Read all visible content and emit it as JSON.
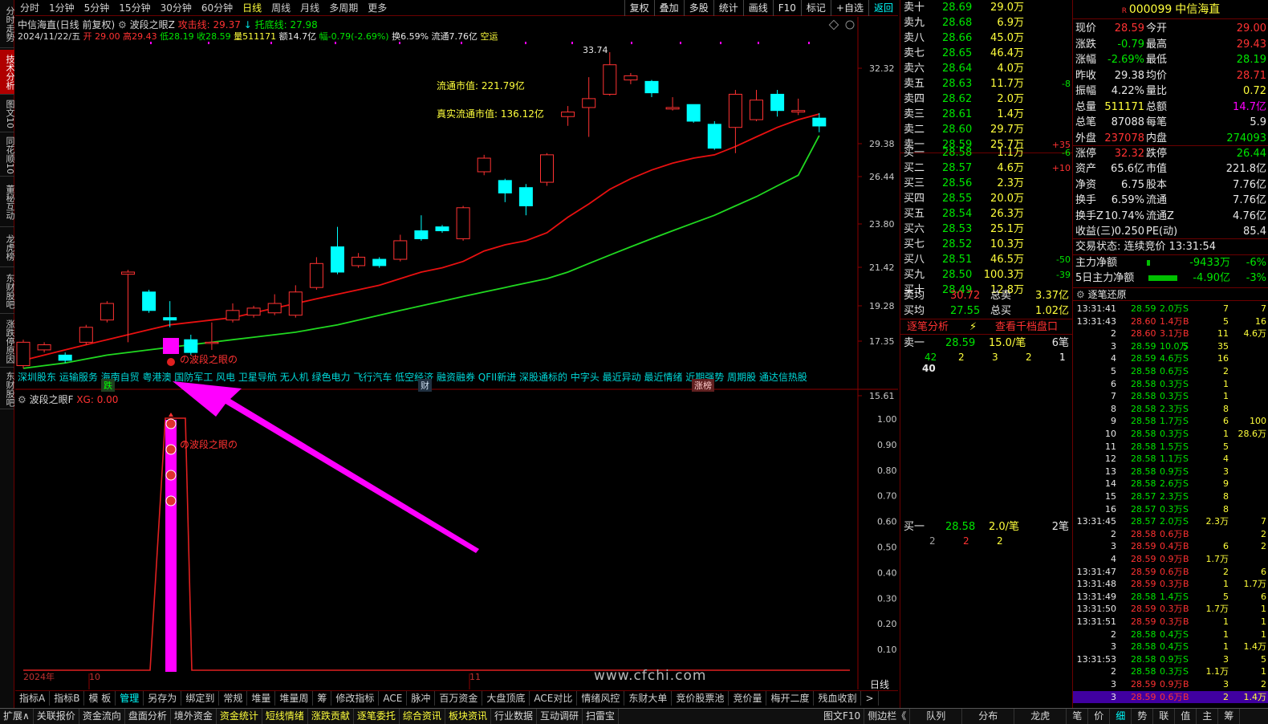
{
  "left_tabs": [
    "分时走势",
    "技术分析",
    "图文10",
    "同花顺10",
    "董秘互动",
    "龙虎榜",
    "东财股吧",
    "涨跌停原因",
    "东财股吧"
  ],
  "period_tabs": [
    "分时",
    "1分钟",
    "5分钟",
    "15分钟",
    "30分钟",
    "60分钟",
    "日线",
    "周线",
    "月线",
    "多周期",
    "更多"
  ],
  "right_buttons": [
    "复权",
    "叠加",
    "多股",
    "统计",
    "画线",
    "F10",
    "标记",
    "+自选",
    "返回"
  ],
  "header": {
    "title": "中信海直(日线 前复权)",
    "indicator": "波段之眼Z",
    "attack": "攻击线: 29.37",
    "support": "托底线: 27.98"
  },
  "info": {
    "date": "2024/11/22/五",
    "open": "开 29.00",
    "high": "高29.43",
    "low": "低28.19",
    "close": "收28.59",
    "vol": "量511171",
    "amt": "额14.7亿",
    "chg": "幅-0.79(-2.69%)",
    "turn": "换6.59%",
    "float": "流通7.76亿",
    "tag": "空运"
  },
  "annot": {
    "float_mv": "流通市值: 221.79亿",
    "real_mv": "真实流通市值: 136.12亿",
    "high": "33.74",
    "eye": "の波段之眼の"
  },
  "concepts": "深圳股东 运输服务 海南自贸 粤港澳 国防军工 风电 卫星导航 无人机 绿色电力 飞行汽车 低空经济 融资融券 QFII新进 深股通标的 中字头 最近异动 最近情绪 近期强势 周期股 通达信热股",
  "event_tags": [
    "跌",
    "财",
    "涨榜"
  ],
  "axis_main": [
    "32.32",
    "29.38",
    "26.44",
    "23.80",
    "21.42",
    "19.28",
    "17.35",
    "15.61"
  ],
  "axis_sub": [
    "1.00",
    "0.90",
    "0.80",
    "0.70",
    "0.60",
    "0.50",
    "0.40",
    "0.30",
    "0.20",
    "0.10"
  ],
  "sub_header": {
    "name": "波段之眼F",
    "xg": "XG: 0.00"
  },
  "date_labels": [
    "2024年",
    "10",
    "11"
  ],
  "watermark": "www.cfchi.com",
  "period_label": "日线",
  "bottom_tabs1": [
    "指标A",
    "指标B",
    "模 板",
    "管理",
    "另存为",
    "绑定到",
    "常规",
    "堆量",
    "堆量周",
    "筹",
    "修改指标",
    "ACE",
    "脉冲",
    "百万资金",
    "大盘顶底",
    "ACE对比",
    "情绪风控",
    "东财大单",
    "竞价股票池",
    "竞价量",
    "梅开二度",
    "残血收割"
  ],
  "bottom_tabs2": [
    "扩展∧",
    "关联报价",
    "资金流向",
    "盘面分析",
    "境外资金",
    "资金统计",
    "短线情绪",
    "涨跌贡献",
    "逐笔委托",
    "综合资讯",
    "板块资讯",
    "行业数据",
    "互动调研",
    "扫雷宝"
  ],
  "bottom_right": [
    "图文F10",
    "侧边栏《",
    "队列",
    "分布",
    "龙虎",
    "笔",
    "价",
    "细",
    "势",
    "联",
    "值",
    "主",
    "筹"
  ],
  "sell": [
    [
      "卖十",
      "28.69",
      "29.0万",
      ""
    ],
    [
      "卖九",
      "28.68",
      "6.9万",
      ""
    ],
    [
      "卖八",
      "28.66",
      "45.0万",
      ""
    ],
    [
      "卖七",
      "28.65",
      "46.4万",
      ""
    ],
    [
      "卖六",
      "28.64",
      "4.0万",
      ""
    ],
    [
      "卖五",
      "28.63",
      "11.7万",
      "-8"
    ],
    [
      "卖四",
      "28.62",
      "2.0万",
      ""
    ],
    [
      "卖三",
      "28.61",
      "1.4万",
      ""
    ],
    [
      "卖二",
      "28.60",
      "29.7万",
      ""
    ],
    [
      "卖一",
      "28.59",
      "25.7万",
      "+35"
    ]
  ],
  "buy": [
    [
      "买一",
      "28.58",
      "1.1万",
      "-6"
    ],
    [
      "买二",
      "28.57",
      "4.6万",
      "+10"
    ],
    [
      "买三",
      "28.56",
      "2.3万",
      ""
    ],
    [
      "买四",
      "28.55",
      "20.0万",
      ""
    ],
    [
      "买五",
      "28.54",
      "26.3万",
      ""
    ],
    [
      "买六",
      "28.53",
      "25.1万",
      ""
    ],
    [
      "买七",
      "28.52",
      "10.3万",
      ""
    ],
    [
      "买八",
      "28.51",
      "46.5万",
      "-50"
    ],
    [
      "买九",
      "28.50",
      "100.3万",
      "-39"
    ],
    [
      "买十",
      "28.49",
      "12.8万",
      ""
    ]
  ],
  "avg": {
    "sell_avg_l": "卖均",
    "sell_avg": "30.72",
    "total_sell_l": "总卖",
    "total_sell": "3.37亿",
    "buy_avg_l": "买均",
    "buy_avg": "27.55",
    "total_buy_l": "总买",
    "total_buy": "1.02亿"
  },
  "tick_tabs": [
    "逐笔分析",
    "查看千档盘口"
  ],
  "queue": {
    "s1_label": "卖一",
    "s1_price": "28.59",
    "s1_vol": "15.0/笔",
    "s1_cnt": "6笔",
    "s1_q": [
      "42",
      "2",
      "3",
      "2",
      "1"
    ],
    "s1_q2": "40",
    "b1_label": "买一",
    "b1_price": "28.58",
    "b1_vol": "2.0/笔",
    "b1_cnt": "2笔",
    "b1_q": [
      "2",
      "2",
      "2"
    ]
  },
  "stock": {
    "code": "000099",
    "name": "中信海直"
  },
  "quote": [
    [
      "现价",
      "28.59",
      "今开",
      "29.00"
    ],
    [
      "涨跌",
      "-0.79",
      "最高",
      "29.43"
    ],
    [
      "涨幅",
      "-2.69%",
      "最低",
      "28.19"
    ],
    [
      "昨收",
      "29.38",
      "均价",
      "28.71"
    ],
    [
      "振幅",
      "4.22%",
      "量比",
      "0.72"
    ],
    [
      "总量",
      "511171",
      "总额",
      "14.7亿"
    ],
    [
      "总笔",
      "87088",
      "每笔",
      "5.9"
    ],
    [
      "外盘",
      "237078",
      "内盘",
      "274093"
    ]
  ],
  "quote2": [
    [
      "涨停",
      "32.32",
      "跌停",
      "26.44"
    ],
    [
      "资产",
      "65.6亿",
      "市值",
      "221.8亿"
    ],
    [
      "净资",
      "6.75",
      "股本",
      "7.76亿"
    ],
    [
      "换手",
      "6.59%",
      "流通",
      "7.76亿"
    ],
    [
      "换手Z",
      "10.74%",
      "流通Z",
      "4.76亿"
    ],
    [
      "收益(三)",
      "0.250",
      "PE(动)",
      "85.4"
    ]
  ],
  "trade_state": "交易状态: 连续竞价 13:31:54",
  "flow": [
    [
      "主力净额",
      "-9433万",
      "-6%"
    ],
    [
      "5日主力净额",
      "-4.90亿",
      "-3%"
    ]
  ],
  "trans_title": "逐笔还原",
  "trans": [
    [
      "13:31:41",
      "28.59",
      "2.0万",
      "S",
      "7",
      "7"
    ],
    [
      "13:31:43",
      "28.60",
      "1.4万",
      "B",
      "5",
      "16"
    ],
    [
      "2",
      "28.60",
      "3.1万",
      "B",
      "11",
      "4.6万"
    ],
    [
      "3",
      "28.59",
      "10.0万",
      "S",
      "35",
      ""
    ],
    [
      "4",
      "28.59",
      "4.6万",
      "S",
      "16",
      ""
    ],
    [
      "5",
      "28.58",
      "0.6万",
      "S",
      "2",
      ""
    ],
    [
      "6",
      "28.58",
      "0.3万",
      "S",
      "1",
      ""
    ],
    [
      "7",
      "28.58",
      "0.3万",
      "S",
      "1",
      ""
    ],
    [
      "8",
      "28.58",
      "2.3万",
      "S",
      "8",
      ""
    ],
    [
      "9",
      "28.58",
      "1.7万",
      "S",
      "6",
      "100"
    ],
    [
      "10",
      "28.58",
      "0.3万",
      "S",
      "1",
      "28.6万"
    ],
    [
      "11",
      "28.58",
      "1.5万",
      "S",
      "5",
      ""
    ],
    [
      "12",
      "28.58",
      "1.1万",
      "S",
      "4",
      ""
    ],
    [
      "13",
      "28.58",
      "0.9万",
      "S",
      "3",
      ""
    ],
    [
      "14",
      "28.58",
      "2.6万",
      "S",
      "9",
      ""
    ],
    [
      "15",
      "28.57",
      "2.3万",
      "S",
      "8",
      ""
    ],
    [
      "16",
      "28.57",
      "0.3万",
      "S",
      "8",
      ""
    ],
    [
      "13:31:45",
      "28.57",
      "2.0万",
      "S",
      "2.3万",
      "7"
    ],
    [
      "2",
      "28.58",
      "0.6万",
      "B",
      "",
      "2"
    ],
    [
      "3",
      "28.59",
      "0.4万",
      "B",
      "6",
      "2"
    ],
    [
      "4",
      "28.59",
      "0.9万",
      "B",
      "1.7万",
      ""
    ],
    [
      "13:31:47",
      "28.59",
      "0.6万",
      "B",
      "2",
      "6"
    ],
    [
      "13:31:48",
      "28.59",
      "0.3万",
      "B",
      "1",
      "1.7万"
    ],
    [
      "13:31:49",
      "28.58",
      "1.4万",
      "S",
      "5",
      "6"
    ],
    [
      "13:31:50",
      "28.59",
      "0.3万",
      "B",
      "1.7万",
      "1"
    ],
    [
      "13:31:51",
      "28.59",
      "0.3万",
      "B",
      "1",
      "1"
    ],
    [
      "2",
      "28.58",
      "0.4万",
      "S",
      "1",
      "1"
    ],
    [
      "3",
      "28.58",
      "0.4万",
      "S",
      "1",
      "1.4万"
    ],
    [
      "13:31:53",
      "28.58",
      "0.9万",
      "S",
      "3",
      "5"
    ],
    [
      "2",
      "28.58",
      "0.3万",
      "S",
      "1.1万",
      "1"
    ],
    [
      "3",
      "28.59",
      "0.9万",
      "B",
      "3",
      "2"
    ],
    [
      "3",
      "28.59",
      "0.6万",
      "B",
      "2",
      "1.4万"
    ]
  ],
  "colors": {
    "up": "#ff3232",
    "down": "#00ffff",
    "ma1": "#e81010",
    "ma2": "#20d820",
    "arrow": "#ff00ff",
    "bg": "#000000"
  },
  "chart_data": {
    "type": "candlestick",
    "ylim": [
      15.61,
      33.74
    ],
    "candles": [
      [
        16.7,
        17.6,
        16.6,
        17.7
      ],
      [
        17.3,
        17.5,
        17.2,
        17.6
      ],
      [
        17.1,
        16.9,
        16.8,
        17.2
      ],
      [
        17.6,
        18.2,
        17.5,
        18.3
      ],
      [
        18.5,
        19.2,
        18.4,
        19.3
      ],
      [
        20.5,
        20.6,
        17.6,
        20.7
      ],
      [
        19.7,
        18.9,
        18.8,
        19.8
      ],
      [
        18.6,
        18.5,
        18.2,
        19.3
      ],
      [
        17.7,
        17.2,
        17.1,
        17.9
      ],
      [
        17.6,
        17.6,
        17.3,
        18.4
      ],
      [
        18.5,
        18.9,
        18.4,
        19.2
      ],
      [
        18.7,
        19.0,
        18.6,
        19.1
      ],
      [
        18.8,
        19.2,
        18.7,
        19.6
      ],
      [
        18.7,
        19.7,
        18.6,
        20.0
      ],
      [
        19.9,
        21.0,
        19.8,
        21.3
      ],
      [
        21.8,
        20.6,
        20.5,
        22.8
      ],
      [
        20.9,
        21.3,
        20.8,
        21.5
      ],
      [
        21.2,
        20.9,
        20.8,
        21.3
      ],
      [
        21.2,
        22.1,
        21.1,
        22.4
      ],
      [
        22.6,
        22.2,
        22.1,
        23.4
      ],
      [
        22.8,
        22.6,
        22.5,
        22.9
      ],
      [
        22.2,
        23.8,
        22.1,
        23.9
      ],
      [
        25.8,
        26.6,
        25.6,
        26.8
      ],
      [
        25.3,
        24.6,
        24.1,
        25.4
      ],
      [
        24.9,
        23.9,
        23.4,
        25.1
      ],
      [
        25.2,
        26.8,
        25.0,
        26.9
      ],
      [
        29.2,
        29.5,
        28.6,
        29.9
      ],
      [
        29.8,
        30.4,
        27.9,
        31.9
      ],
      [
        30.7,
        32.8,
        30.6,
        33.74
      ],
      [
        31.7,
        32.0,
        31.4,
        32.2
      ],
      [
        31.6,
        30.8,
        30.5,
        31.7
      ],
      [
        29.7,
        29.8,
        29.6,
        30.5
      ],
      [
        30.0,
        28.9,
        28.8,
        30.0
      ],
      [
        28.7,
        27.2,
        27.1,
        28.9
      ],
      [
        28.5,
        30.7,
        26.9,
        31.0
      ],
      [
        29.0,
        30.3,
        28.9,
        31.0
      ],
      [
        30.7,
        29.6,
        29.2,
        31.0
      ],
      [
        29.5,
        29.6,
        29.3,
        30.4
      ],
      [
        29.1,
        28.59,
        28.19,
        29.43
      ]
    ],
    "ma_attack": [
      16.9,
      17.1,
      17.3,
      17.5,
      17.7,
      17.9,
      18.1,
      18.3,
      18.4,
      18.5,
      18.6,
      18.8,
      19.0,
      19.2,
      19.4,
      19.6,
      19.8,
      20.0,
      20.3,
      20.6,
      20.8,
      21.1,
      21.6,
      21.9,
      22.1,
      22.5,
      23.3,
      24.0,
      24.8,
      25.4,
      25.9,
      26.3,
      26.6,
      26.8,
      27.3,
      27.9,
      28.5,
      29.0,
      29.37
    ],
    "ma_support": [
      16.6,
      16.7,
      16.8,
      16.95,
      17.1,
      17.2,
      17.3,
      17.4,
      17.5,
      17.6,
      17.7,
      17.8,
      17.9,
      18.0,
      18.15,
      18.3,
      18.5,
      18.7,
      18.9,
      19.1,
      19.3,
      19.5,
      19.7,
      19.9,
      20.1,
      20.3,
      20.6,
      21.0,
      21.4,
      21.8,
      22.2,
      22.6,
      23.0,
      23.4,
      23.9,
      24.4,
      25.0,
      25.6,
      27.98
    ]
  }
}
